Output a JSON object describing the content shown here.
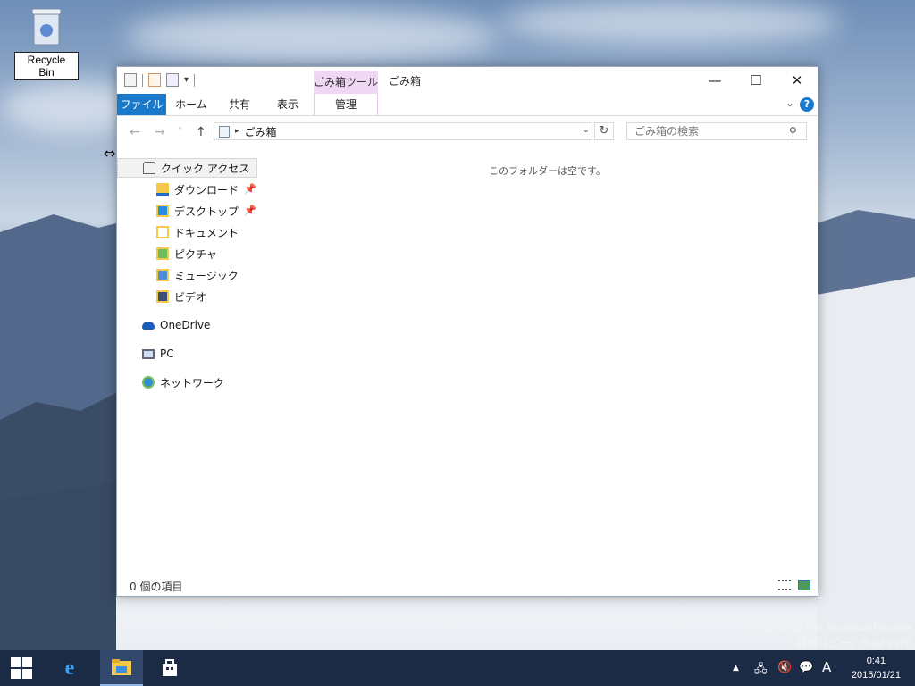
{
  "desktop": {
    "recycle_bin_label": "Recycle Bin",
    "watermark_line1": "Windows 10 Pro Technical Preview",
    "watermark_line2": "評価コピー。Build 9926"
  },
  "window": {
    "title": "ごみ箱",
    "context_tab_group": "ごみ箱ツール",
    "minimize": "—",
    "maximize": "☐",
    "close": "✕"
  },
  "ribbon": {
    "tabs": [
      {
        "label": "ファイル",
        "active": true
      },
      {
        "label": "ホーム"
      },
      {
        "label": "共有"
      },
      {
        "label": "表示"
      },
      {
        "label": "管理"
      }
    ],
    "help": "?"
  },
  "nav": {
    "back": "←",
    "forward": "→",
    "recent": "˅",
    "up": "↑",
    "address": "ごみ箱",
    "search_placeholder": "ごみ箱の検索"
  },
  "navpane": {
    "quick_access": "クイック アクセス",
    "items": [
      {
        "label": "ダウンロード",
        "pinned": true
      },
      {
        "label": "デスクトップ",
        "pinned": true
      },
      {
        "label": "ドキュメント"
      },
      {
        "label": "ピクチャ"
      },
      {
        "label": "ミュージック"
      },
      {
        "label": "ビデオ"
      }
    ],
    "onedrive": "OneDrive",
    "pc": "PC",
    "network": "ネットワーク"
  },
  "content": {
    "empty_message": "このフォルダーは空です。"
  },
  "status": {
    "item_count": "0 個の項目"
  },
  "taskbar": {
    "ime": "A",
    "time": "0:41",
    "date": "2015/01/21"
  },
  "colors": {
    "accent": "#1979ca",
    "context_tab": "#f0d8f4",
    "taskbar": "#1c2b45"
  }
}
